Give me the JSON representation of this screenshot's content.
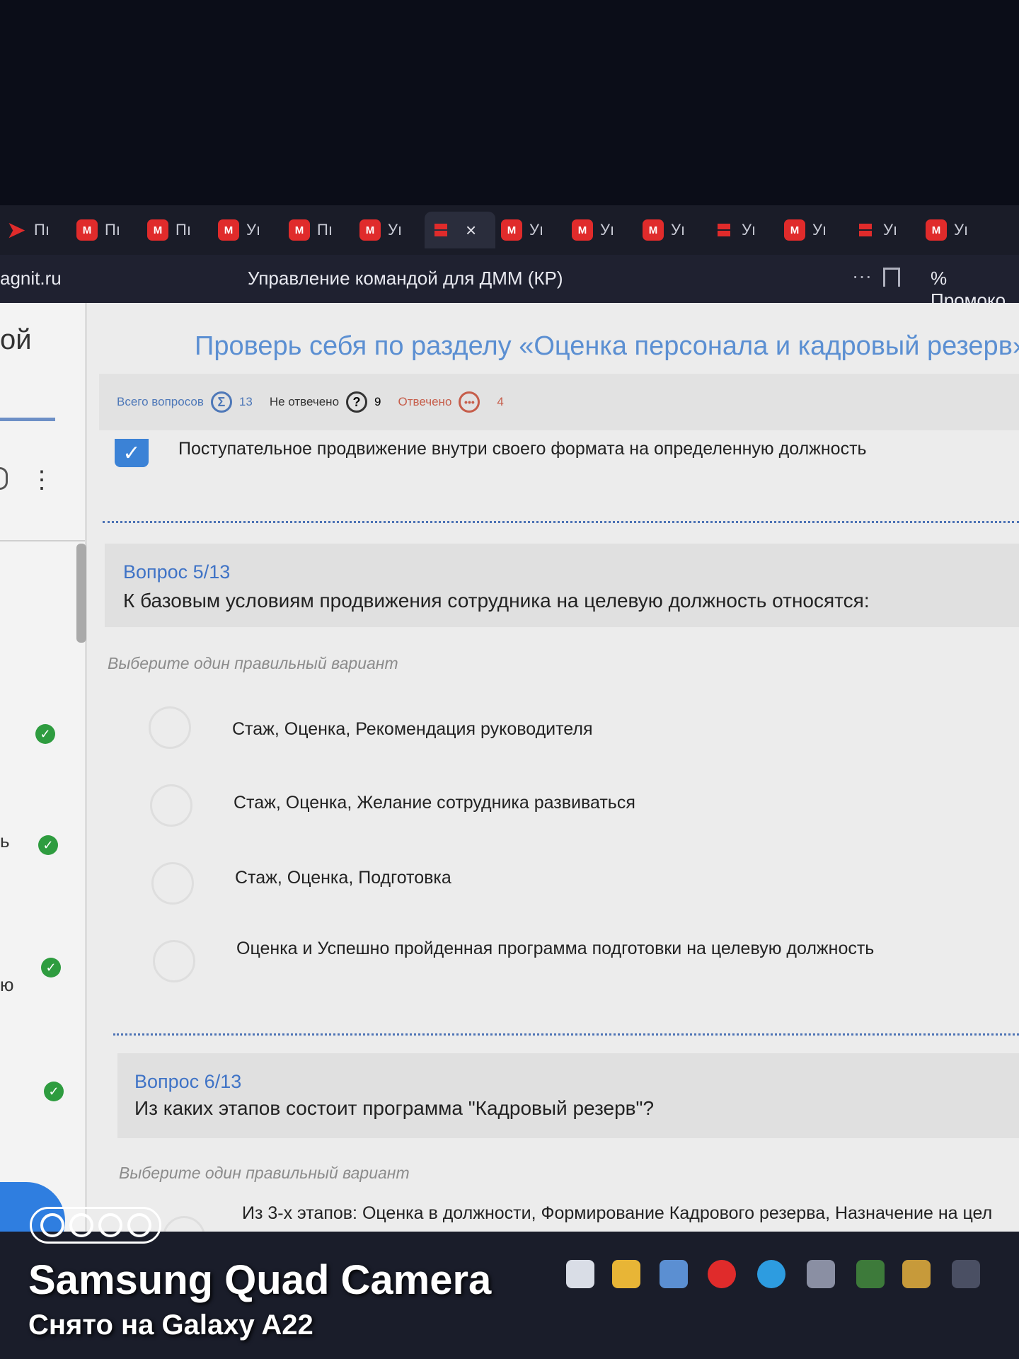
{
  "browser": {
    "tabs": [
      {
        "label": "Пı",
        "icon": "arrow-icon"
      },
      {
        "label": "Пı",
        "icon": "magnit-m-icon"
      },
      {
        "label": "Пı",
        "icon": "magnit-icon"
      },
      {
        "label": "Уı",
        "icon": "magnit-icon"
      },
      {
        "label": "Пı",
        "icon": "magnit-icon"
      },
      {
        "label": "Уı",
        "icon": "magnit-icon"
      },
      {
        "label": "×",
        "icon": "bars-icon",
        "active": true
      },
      {
        "label": "Уı",
        "icon": "magnit-icon"
      },
      {
        "label": "Уı",
        "icon": "magnit-icon"
      },
      {
        "label": "Уı",
        "icon": "magnit-icon"
      },
      {
        "label": "Уı",
        "icon": "bars-icon"
      },
      {
        "label": "Уı",
        "icon": "magnit-icon"
      },
      {
        "label": "Уı",
        "icon": "bars-icon"
      },
      {
        "label": "Уı",
        "icon": "magnit-icon"
      }
    ],
    "domain": "agnit.ru",
    "page_title": "Управление командой для ДММ (КР)",
    "more": "···",
    "promo": "Промоко"
  },
  "sidebar": {
    "title_fragment": "ой",
    "fragments": [
      "ь",
      "ю"
    ]
  },
  "quiz": {
    "title": "Проверь себя по разделу «Оценка персонала и кадровый резерв» ,",
    "stats": {
      "total_label": "Всего вопросов",
      "total_value": "13",
      "unanswered_label": "Не отвечено",
      "unanswered_value": "9",
      "answered_label": "Отвечено",
      "answered_value": "4"
    },
    "previous_answer": "Поступательное продвижение внутри своего формата на определенную должность",
    "questions": [
      {
        "number": "Вопрос 5/13",
        "text": "К базовым условиям продвижения сотрудника на целевую должность относятся:",
        "hint": "Выберите один правильный вариант",
        "options": [
          "Стаж, Оценка, Рекомендация руководителя",
          "Стаж, Оценка, Желание сотрудника развиваться",
          "Стаж, Оценка, Подготовка",
          "Оценка и Успешно пройденная программа подготовки на целевую должность"
        ]
      },
      {
        "number": "Вопрос 6/13",
        "text": "Из каких этапов состоит программа \"Кадровый резерв\"?",
        "hint": "Выберите один правильный вариант",
        "options": [
          "Из 3-х этапов: Оценка в должности, Формирование Кадрового резерва, Назначение на цел"
        ]
      }
    ]
  },
  "overlay": {
    "camera_line1": "Samsung Quad Camera",
    "camera_line2": "Снято на Galaxy A22"
  },
  "colors": {
    "accent_blue": "#3f73c6",
    "check_green": "#2e9c3f",
    "tab_red": "#e02b2b"
  }
}
